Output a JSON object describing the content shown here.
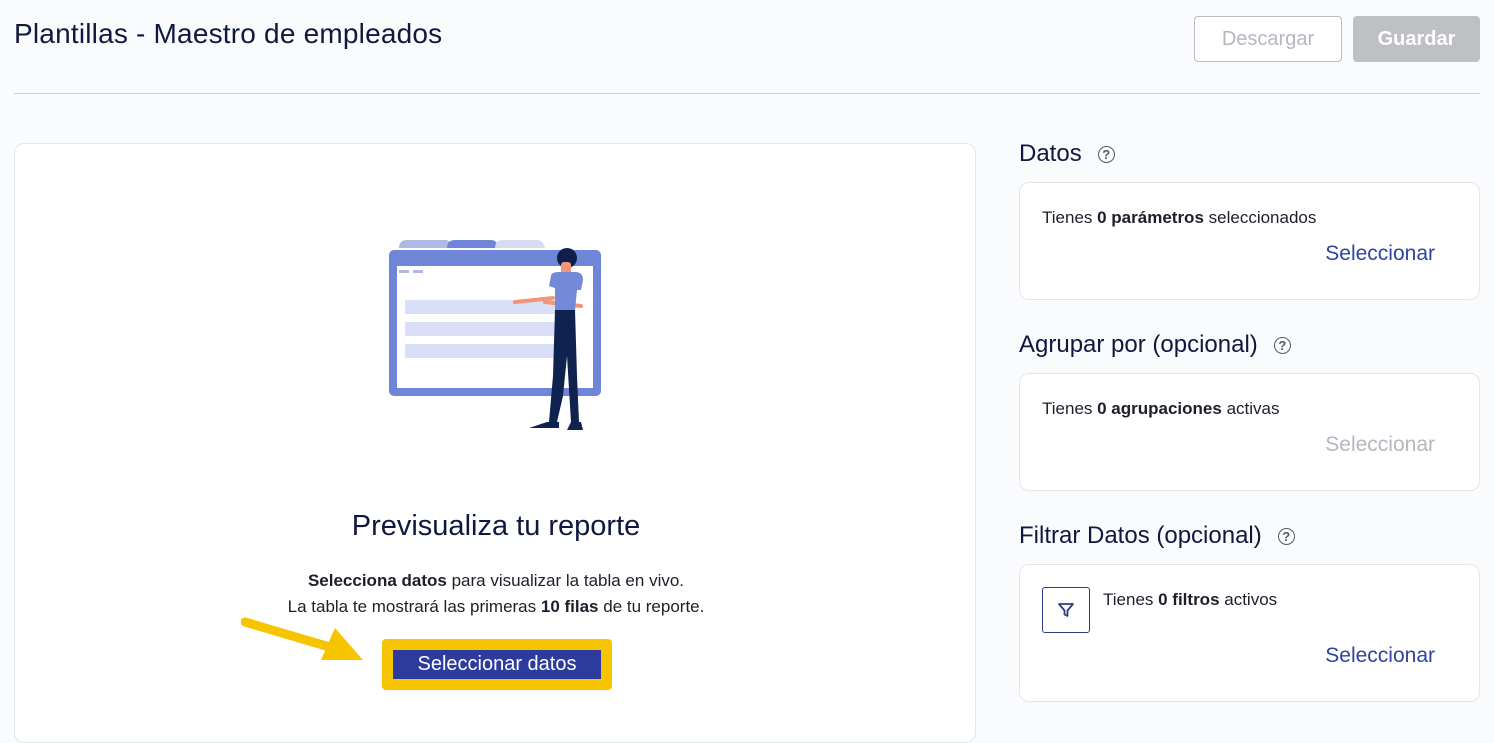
{
  "header": {
    "title": "Plantillas - Maestro de empleados",
    "download_label": "Descargar",
    "save_label": "Guardar"
  },
  "preview": {
    "title": "Previsualiza tu reporte",
    "line1_bold": "Selecciona datos",
    "line1_rest": " para visualizar la tabla en vivo.",
    "line2_start": "La tabla te mostrará las primeras ",
    "line2_bold": "10 filas",
    "line2_end": " de tu reporte.",
    "button_label": "Seleccionar datos"
  },
  "sidebar": {
    "datos": {
      "title": "Datos",
      "info_start": "Tienes ",
      "info_bold": "0 parámetros",
      "info_end": " seleccionados",
      "action": "Seleccionar"
    },
    "agrupar": {
      "title": "Agrupar por (opcional)",
      "info_start": "Tienes ",
      "info_bold": "0 agrupaciones",
      "info_end": " activas",
      "action": "Seleccionar"
    },
    "filtrar": {
      "title": "Filtrar Datos (opcional)",
      "info_start": "Tienes ",
      "info_bold": "0 filtros",
      "info_end": " activos",
      "action": "Seleccionar"
    },
    "help_glyph": "?"
  },
  "colors": {
    "primary": "#2d3b9d",
    "link": "#2e44a0",
    "highlight": "#f7c400",
    "disabled": "#b4b7bf"
  },
  "icons": [
    "help-icon",
    "filter-icon",
    "arrow-annotation",
    "report-illustration"
  ]
}
